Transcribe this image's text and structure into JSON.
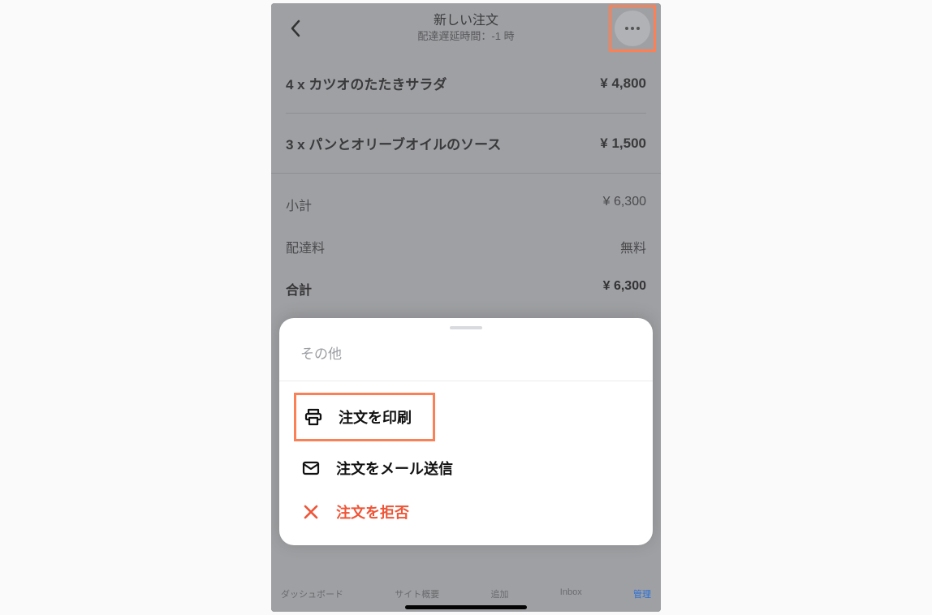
{
  "header": {
    "title": "新しい注文",
    "subtitle": "配達遅延時間：-1 時"
  },
  "items": [
    {
      "label": "4 x カツオのたたきサラダ",
      "price": "¥ 4,800"
    },
    {
      "label": "3 x パンとオリーブオイルのソース",
      "price": "¥ 1,500"
    }
  ],
  "totals": {
    "subtotal_label": "小計",
    "subtotal_value": "¥ 6,300",
    "shipping_label": "配達料",
    "shipping_value": "無料",
    "total_label": "合計",
    "total_value": "¥ 6,300"
  },
  "sheet": {
    "title": "その他",
    "options": {
      "print": "注文を印刷",
      "email": "注文をメール送信",
      "reject": "注文を拒否"
    }
  },
  "nav": {
    "dashboard": "ダッシュボード",
    "overview": "サイト概要",
    "add": "追加",
    "inbox": "Inbox",
    "manage": "管理"
  },
  "colors": {
    "highlight": "#fb8055",
    "reject": "#ef5537",
    "active_nav": "#2a6fd6"
  }
}
